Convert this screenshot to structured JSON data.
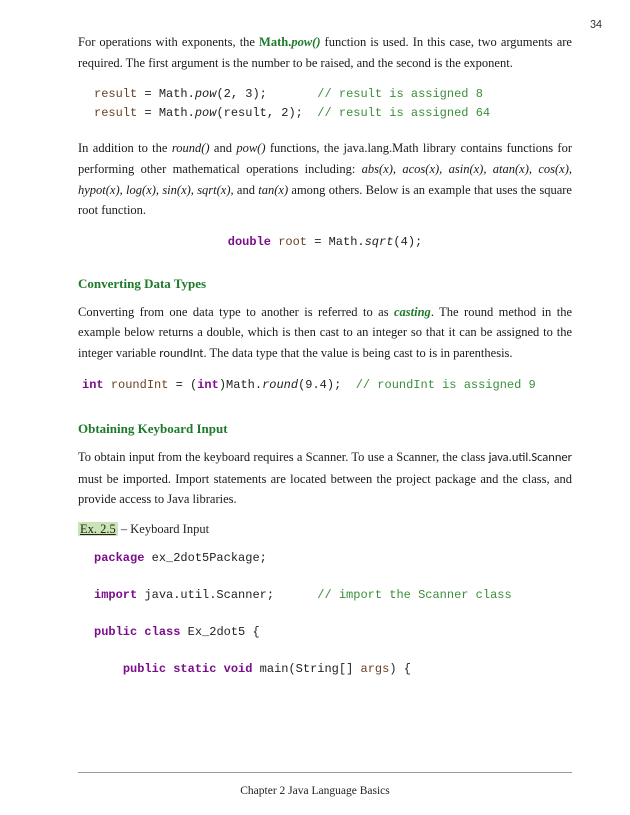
{
  "page_number": "34",
  "para1_a": "For operations with exponents, the ",
  "para1_math": "Math.",
  "para1_pow": "pow()",
  "para1_b": " function is used.  In this case, two arguments are required.  The first argument is the number to be raised, and the second is the exponent.",
  "code1": {
    "l1_id": "result",
    "l1_a": " = Math.",
    "l1_m": "pow",
    "l1_b": "(2, 3);       ",
    "l1_c": "// result is assigned 8",
    "l2_id": "result",
    "l2_a": " = Math.",
    "l2_m": "pow",
    "l2_b": "(result, 2);  ",
    "l2_c": "// result is assigned 64"
  },
  "para2_a": "In addition to the ",
  "para2_r": "round()",
  "para2_b": " and ",
  "para2_p": "pow()",
  "para2_c": " functions, the java.lang.Math library contains functions for performing other mathematical operations including: ",
  "para2_fns": "abs(x), acos(x), asin(x), atan(x), cos(x), hypot(x), log(x), sin(x), sqrt(x),",
  "para2_d": " and ",
  "para2_tan": "tan(x)",
  "para2_e": " among others. Below is an example that uses the square root function.",
  "code2": {
    "kw": "double",
    "a": " ",
    "id": "root",
    "b": " = Math.",
    "m": "sqrt",
    "c": "(4);"
  },
  "section1": "Converting Data Types",
  "para3_a": "Converting from one data type to another is referred to as ",
  "para3_cast": "casting",
  "para3_b": ".  The round method in the example below returns a double, which is then cast to an integer so that it can be assigned to the integer variable ",
  "para3_ri": "roundInt",
  "para3_c": ".  The data type that the value is being cast to is in parenthesis.",
  "code3": {
    "kw": "int",
    "a": " ",
    "id": "roundInt",
    "b": " = (",
    "kw2": "int",
    "c": ")Math.",
    "m": "round",
    "d": "(9.4);  ",
    "cm": "// roundInt is assigned 9"
  },
  "section2": "Obtaining Keyboard Input",
  "para4_a": "To obtain input from the keyboard requires a Scanner.  To use a Scanner, the class ",
  "para4_sc": "java.util.Scanner",
  "para4_b": " must be imported.  Import statements are located between the project package and the class, and provide access to Java libraries.",
  "ex_label": "Ex. 2.5",
  "ex_title": " – Keyboard Input",
  "code4": {
    "l1_kw": "package",
    "l1_a": " ex_2dot5Package;",
    "l2_kw": "import",
    "l2_a": " java.util.Scanner;      ",
    "l2_cm": "// import the Scanner class",
    "l3_kw1": "public",
    "l3_kw2": "class",
    "l3_a": " Ex_2dot5 {",
    "l4_kw1": "public",
    "l4_kw2": "static",
    "l4_kw3": "void",
    "l4_a": " main(String[] ",
    "l4_id": "args",
    "l4_b": ") {"
  },
  "footer": "Chapter 2 Java Language Basics"
}
